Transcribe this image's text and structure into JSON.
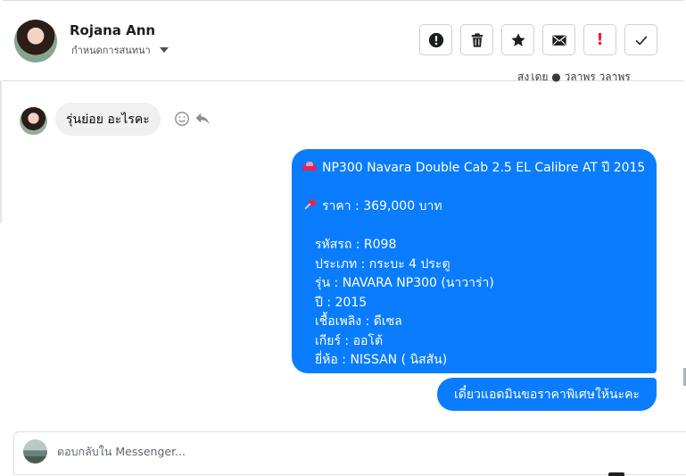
{
  "header": {
    "name": "Rojana Ann",
    "subtitle": "กำหนดการสนทนา"
  },
  "toolbar": {
    "buttons": [
      {
        "id": "report",
        "icon": "exclamation-circle-icon"
      },
      {
        "id": "delete",
        "icon": "trash-icon"
      },
      {
        "id": "star",
        "icon": "star-icon"
      },
      {
        "id": "email",
        "icon": "envelope-icon"
      },
      {
        "id": "important",
        "icon": "red-exclamation-icon",
        "label": "!"
      },
      {
        "id": "done",
        "icon": "checkmark-icon"
      }
    ]
  },
  "meta": {
    "sent_by_partial": "ส่งโดย ● วิลาพร วิลาพร"
  },
  "messages": {
    "incoming": {
      "text": "รุ่นย่อย อะไรคะ"
    },
    "outgoing_listing": {
      "title": "NP300 Navara Double Cab 2.5 EL Calibre AT ปี 2015",
      "price": "ราคา : 369,000 บาท",
      "details": [
        "รหัสรถ : R098",
        "ประเภท : กระบะ 4 ประตู",
        "รุ่น : NAVARA NP300 (นาวาร่า)",
        "ปี : 2015",
        "เชื้อเพลิง : ดีเซล",
        "เกียร์ : ออโต้",
        "ยี่ห้อ : NISSAN ( นิสสัน)"
      ]
    },
    "outgoing_note": {
      "text": "เดี๋ยวแอดมินขอราคาพิเศษให้นะคะ"
    }
  },
  "composer": {
    "placeholder": "ตอบกลับใน Messenger..."
  },
  "colors": {
    "brand_blue": "#0a7cff",
    "incoming_bubble": "#f0f0f0",
    "important_red": "#e41e3f"
  }
}
